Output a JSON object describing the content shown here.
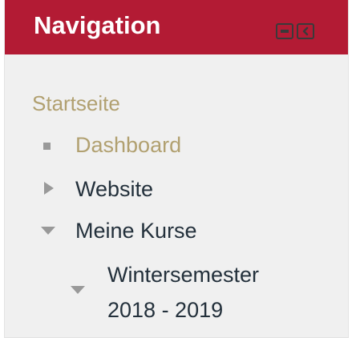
{
  "header": {
    "title": "Navigation",
    "buttons": [
      {
        "name": "collapse",
        "icon": "minus-square-icon"
      },
      {
        "name": "dock",
        "icon": "dock-left-icon"
      }
    ]
  },
  "tree": {
    "home": {
      "label": "Startseite"
    },
    "dashboard": {
      "label": "Dashboard",
      "icon": "bullet-square-icon"
    },
    "website": {
      "label": "Website",
      "icon": "triangle-right-icon"
    },
    "my_courses": {
      "label": "Meine Kurse",
      "icon": "triangle-down-icon"
    },
    "semester": {
      "label_line1": "Wintersemester",
      "label_line2": "2018 - 2019",
      "icon": "triangle-down-icon"
    }
  },
  "colors": {
    "header_bg": "#b31b34",
    "block_bg": "#f0f0f0",
    "link_gold": "#b1a070",
    "text_dark": "#23303b",
    "icon_gray": "#999999"
  }
}
